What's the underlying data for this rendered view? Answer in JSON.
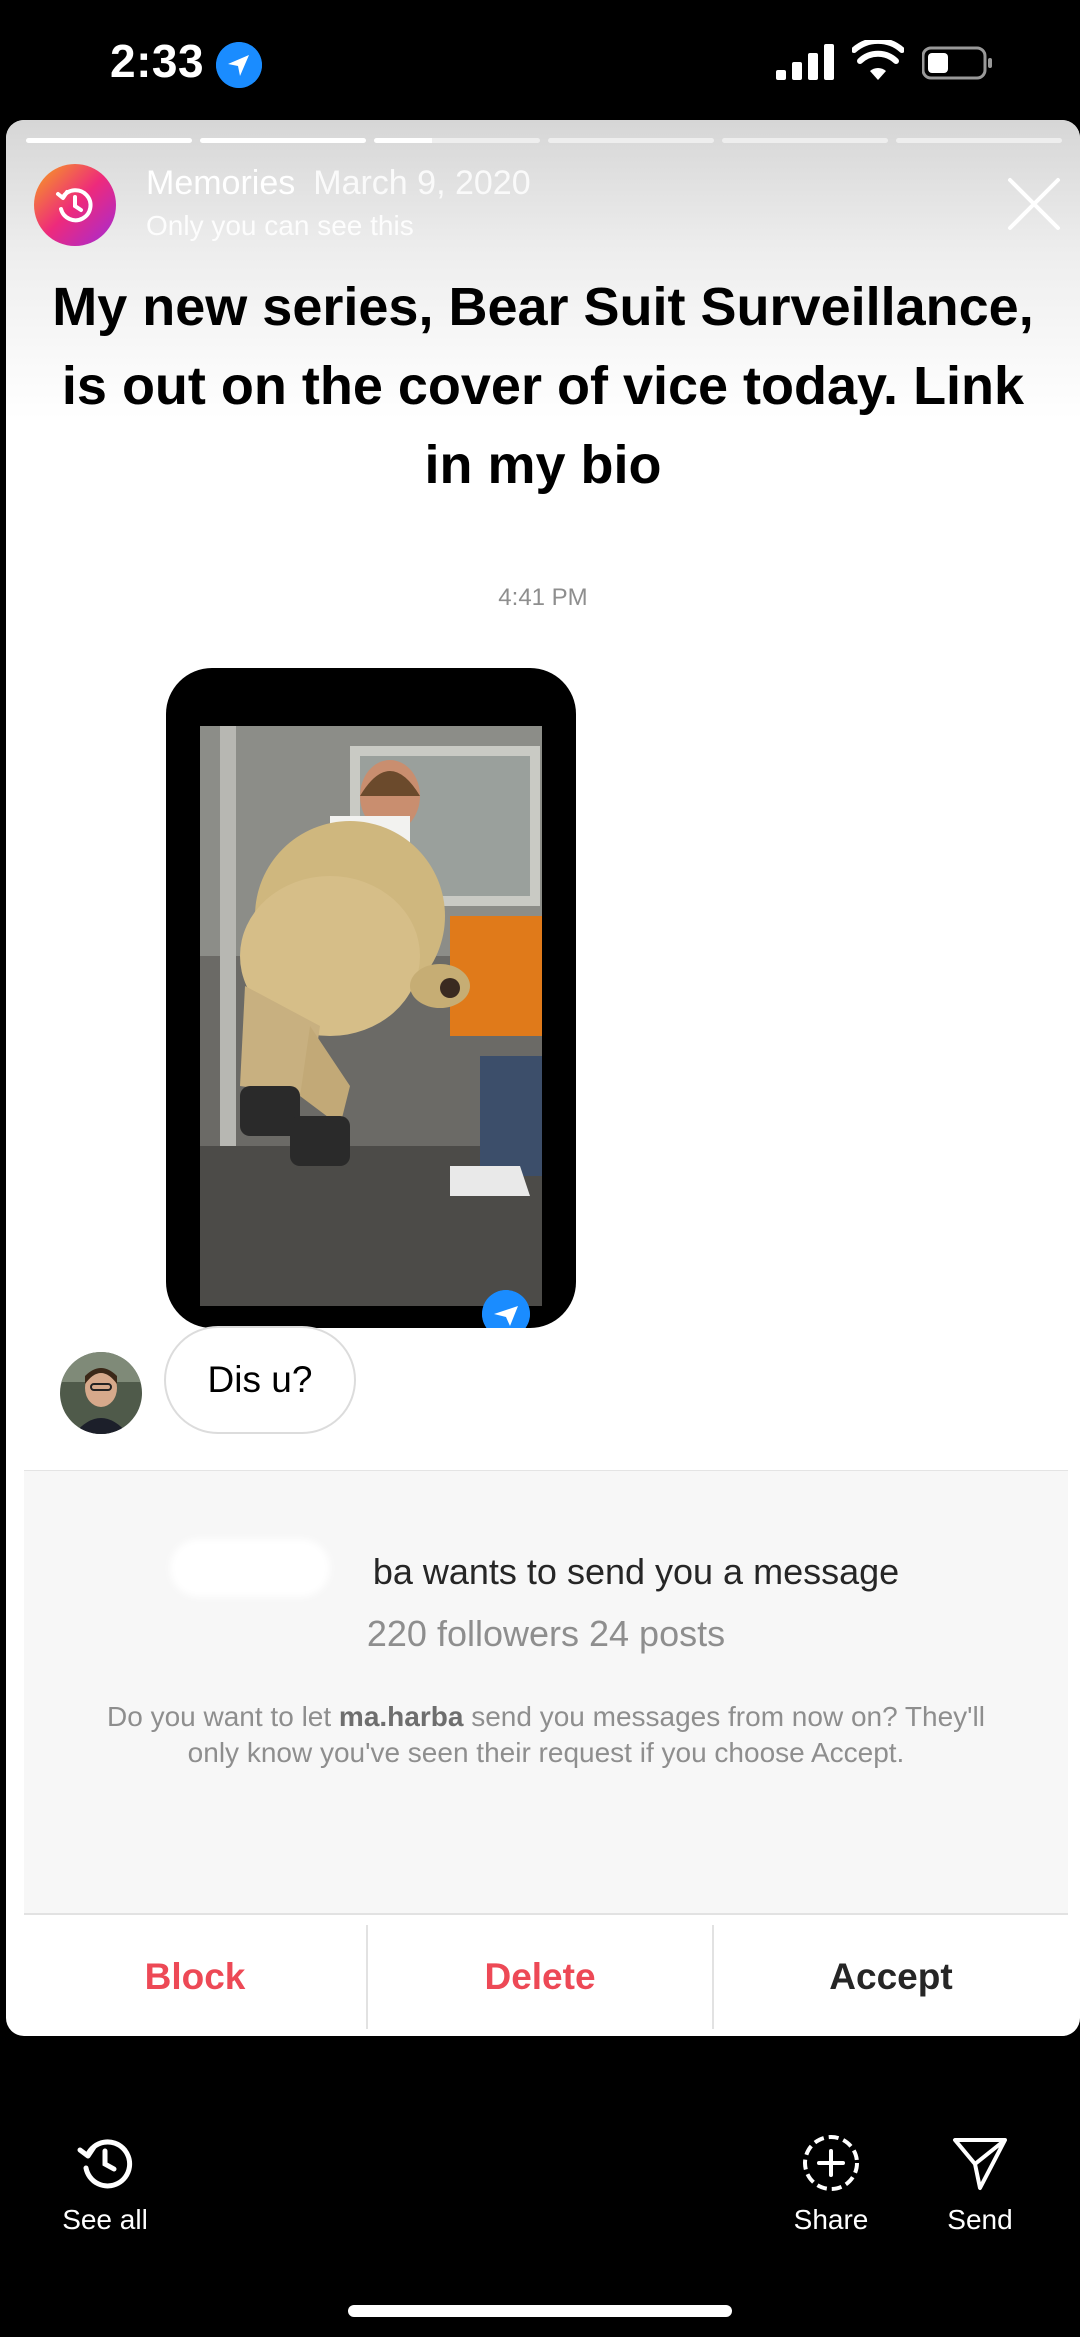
{
  "status_bar": {
    "time": "2:33"
  },
  "story": {
    "header": {
      "title": "Memories",
      "date": "March 9, 2020",
      "subtitle": "Only you can see this"
    },
    "caption": "My new series, Bear Suit Surveillance, is out on the cover of vice today. Link in my bio",
    "progress": {
      "segments": 6,
      "completed": 2,
      "current_fraction": 0.35
    }
  },
  "chat": {
    "timestamp": "4:41 PM",
    "message": "Dis u?"
  },
  "request": {
    "title_partial": "ba wants to send you a message",
    "stats": "220 followers 24 posts",
    "desc_prefix": "Do you want to let ",
    "username": "ma.harba",
    "desc_suffix": " send you messages from now on? They'll only know you've seen their request if you choose Accept.",
    "actions": {
      "block": "Block",
      "delete": "Delete",
      "accept": "Accept"
    },
    "colors": {
      "destructive": "#ed4956",
      "primary": "#262626"
    }
  },
  "bottom_bar": {
    "see_all": "See all",
    "share": "Share",
    "send": "Send"
  }
}
